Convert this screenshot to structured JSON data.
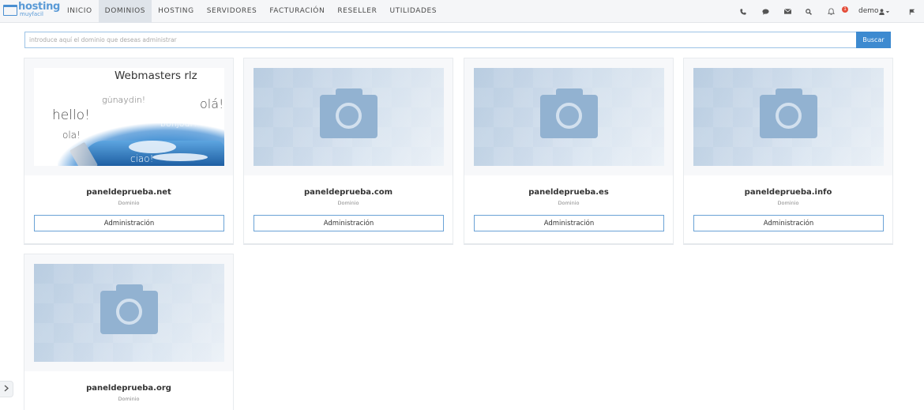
{
  "logo": {
    "text_main": "hosting",
    "text_sub": "muyfacil"
  },
  "nav": {
    "items": [
      {
        "label": "INICIO",
        "active": false
      },
      {
        "label": "DOMINIOS",
        "active": true
      },
      {
        "label": "HOSTING",
        "active": false
      },
      {
        "label": "SERVIDORES",
        "active": false
      },
      {
        "label": "FACTURACIÓN",
        "active": false
      },
      {
        "label": "RESELLER",
        "active": false
      },
      {
        "label": "UTILIDADES",
        "active": false
      }
    ],
    "icons": [
      "phone-icon",
      "chat-icon",
      "mail-icon",
      "search-icon",
      "bell-icon",
      "user-icon",
      "flag-icon"
    ],
    "notification_count": "1",
    "user": "demo"
  },
  "search": {
    "placeholder": "introduce aquí el dominio que deseas administrar",
    "button_label": "Buscar"
  },
  "cards": [
    {
      "domain": "paneldeprueba.net",
      "type": "Dominio",
      "button": "Administración",
      "image": "webmasters"
    },
    {
      "domain": "paneldeprueba.com",
      "type": "Dominio",
      "button": "Administración",
      "image": "placeholder"
    },
    {
      "domain": "paneldeprueba.es",
      "type": "Dominio",
      "button": "Administración",
      "image": "placeholder"
    },
    {
      "domain": "paneldeprueba.info",
      "type": "Dominio",
      "button": "Administración",
      "image": "placeholder"
    },
    {
      "domain": "paneldeprueba.org",
      "type": "Dominio",
      "button": "Administración",
      "image": "placeholder"
    }
  ],
  "webmasters_image": {
    "title": "Webmasters rlz",
    "words": [
      "günaydin!",
      "olá!",
      "hello!",
      "bonjour!",
      "ola!",
      "ciao!"
    ]
  },
  "colors": {
    "accent": "#3d8ad0",
    "nav_active": "#dfe4ea",
    "badge": "#e44d3a"
  }
}
